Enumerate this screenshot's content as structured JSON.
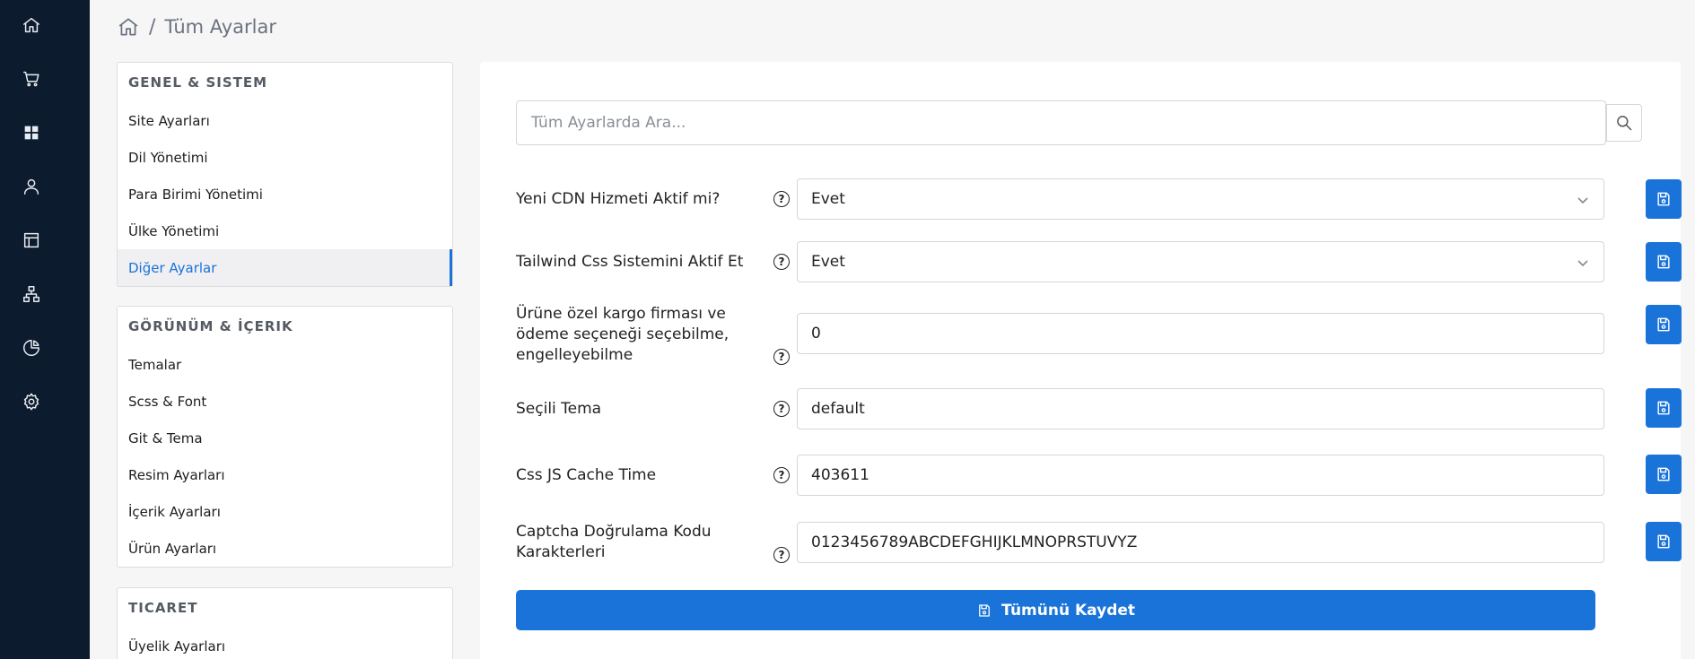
{
  "breadcrumb": {
    "separator": "/",
    "title": "Tüm Ayarlar"
  },
  "rail": {
    "items": [
      {
        "icon": "home-icon"
      },
      {
        "icon": "cart-icon"
      },
      {
        "icon": "grid-icon"
      },
      {
        "icon": "user-icon"
      },
      {
        "icon": "layout-icon"
      },
      {
        "icon": "sitemap-icon"
      },
      {
        "icon": "pie-chart-icon"
      },
      {
        "icon": "gear-icon"
      }
    ]
  },
  "nav": {
    "groups": [
      {
        "title": "GENEL & SISTEM",
        "items": [
          "Site Ayarları",
          "Dil Yönetimi",
          "Para Birimi Yönetimi",
          "Ülke Yönetimi",
          "Diğer Ayarlar"
        ]
      },
      {
        "title": "GÖRÜNÜM & İÇERIK",
        "items": [
          "Temalar",
          "Scss & Font",
          "Git & Tema",
          "Resim Ayarları",
          "İçerik Ayarları",
          "Ürün Ayarları"
        ]
      },
      {
        "title": "TICARET",
        "items": [
          "Üyelik Ayarları"
        ]
      }
    ],
    "active_item": "Diğer Ayarlar"
  },
  "search": {
    "placeholder": "Tüm Ayarlarda Ara..."
  },
  "settings": [
    {
      "label": "Yeni CDN Hizmeti Aktif mi?",
      "value": "Evet",
      "type": "select"
    },
    {
      "label": "Tailwind Css Sistemini Aktif Et",
      "value": "Evet",
      "type": "select"
    },
    {
      "label": "Ürüne özel kargo firması ve ödeme seçeneği seçebilme, engelleyebilme",
      "value": "0",
      "type": "text"
    },
    {
      "label": "Seçili Tema",
      "value": "default",
      "type": "text"
    },
    {
      "label": "Css JS Cache Time",
      "value": "403611",
      "type": "text"
    },
    {
      "label": "Captcha Doğrulama Kodu Karakterleri",
      "value": "0123456789ABCDEFGHIJKLMNOPRSTUVYZ",
      "type": "text"
    }
  ],
  "help_symbol": "?",
  "save_all_label": "Tümünü Kaydet",
  "colors": {
    "accent": "#1a73d9",
    "rail_bg": "#0d1b2e"
  }
}
